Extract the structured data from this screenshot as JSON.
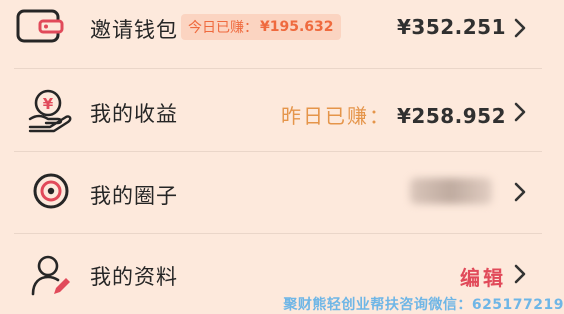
{
  "menu": [
    {
      "label": "邀请钱包",
      "badge_prefix": "今日已赚：",
      "badge_value": "¥195.632",
      "value": "¥352.251",
      "icon": "wallet-icon"
    },
    {
      "label": "我的收益",
      "prefix": "昨日已赚：",
      "value": "¥258.952",
      "icon": "money-hand-icon"
    },
    {
      "label": "我的圈子",
      "value": "",
      "icon": "circle-target-icon"
    },
    {
      "label": "我的资料",
      "action": "编辑",
      "icon": "user-edit-icon"
    }
  ],
  "watermark": "聚财熊轻创业帮扶咨询微信：625177219",
  "colors": {
    "background": "#fde9dc",
    "accent_orange": "#ef6a3e",
    "accent_red": "#e14a5a",
    "gold": "#e5954a"
  }
}
